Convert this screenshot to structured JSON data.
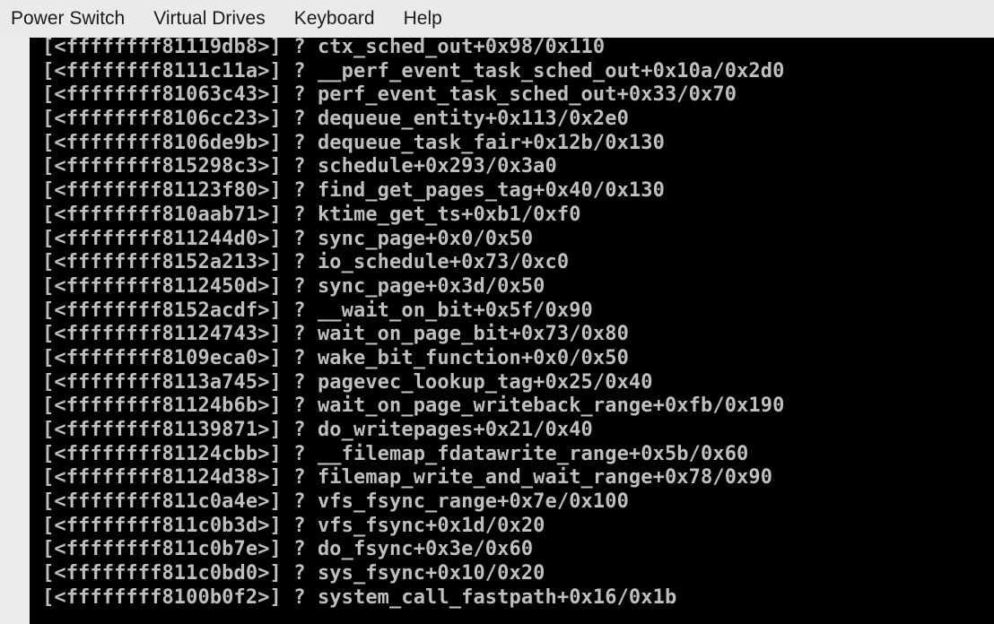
{
  "menubar": {
    "items": [
      {
        "label": "Power Switch"
      },
      {
        "label": "Virtual Drives"
      },
      {
        "label": "Keyboard"
      },
      {
        "label": "Help"
      }
    ]
  },
  "console": {
    "lines": [
      {
        "addr": "[<ffffffff81119db8>]",
        "sym": "? ctx_sched_out+0x98/0x110"
      },
      {
        "addr": "[<ffffffff8111c11a>]",
        "sym": "? __perf_event_task_sched_out+0x10a/0x2d0"
      },
      {
        "addr": "[<ffffffff81063c43>]",
        "sym": "? perf_event_task_sched_out+0x33/0x70"
      },
      {
        "addr": "[<ffffffff8106cc23>]",
        "sym": "? dequeue_entity+0x113/0x2e0"
      },
      {
        "addr": "[<ffffffff8106de9b>]",
        "sym": "? dequeue_task_fair+0x12b/0x130"
      },
      {
        "addr": "[<ffffffff815298c3>]",
        "sym": "? schedule+0x293/0x3a0"
      },
      {
        "addr": "[<ffffffff81123f80>]",
        "sym": "? find_get_pages_tag+0x40/0x130"
      },
      {
        "addr": "[<ffffffff810aab71>]",
        "sym": "? ktime_get_ts+0xb1/0xf0"
      },
      {
        "addr": "[<ffffffff811244d0>]",
        "sym": "? sync_page+0x0/0x50"
      },
      {
        "addr": "[<ffffffff8152a213>]",
        "sym": "? io_schedule+0x73/0xc0"
      },
      {
        "addr": "[<ffffffff8112450d>]",
        "sym": "? sync_page+0x3d/0x50"
      },
      {
        "addr": "[<ffffffff8152acdf>]",
        "sym": "? __wait_on_bit+0x5f/0x90"
      },
      {
        "addr": "[<ffffffff81124743>]",
        "sym": "? wait_on_page_bit+0x73/0x80"
      },
      {
        "addr": "[<ffffffff8109eca0>]",
        "sym": "? wake_bit_function+0x0/0x50"
      },
      {
        "addr": "[<ffffffff8113a745>]",
        "sym": "? pagevec_lookup_tag+0x25/0x40"
      },
      {
        "addr": "[<ffffffff81124b6b>]",
        "sym": "? wait_on_page_writeback_range+0xfb/0x190"
      },
      {
        "addr": "[<ffffffff81139871>]",
        "sym": "? do_writepages+0x21/0x40"
      },
      {
        "addr": "[<ffffffff81124cbb>]",
        "sym": "? __filemap_fdatawrite_range+0x5b/0x60"
      },
      {
        "addr": "[<ffffffff81124d38>]",
        "sym": "? filemap_write_and_wait_range+0x78/0x90"
      },
      {
        "addr": "[<ffffffff811c0a4e>]",
        "sym": "? vfs_fsync_range+0x7e/0x100"
      },
      {
        "addr": "[<ffffffff811c0b3d>]",
        "sym": "? vfs_fsync+0x1d/0x20"
      },
      {
        "addr": "[<ffffffff811c0b7e>]",
        "sym": "? do_fsync+0x3e/0x60"
      },
      {
        "addr": "[<ffffffff811c0bd0>]",
        "sym": "? sys_fsync+0x10/0x20"
      },
      {
        "addr": "[<ffffffff8100b0f2>]",
        "sym": "? system_call_fastpath+0x16/0x1b"
      }
    ]
  }
}
